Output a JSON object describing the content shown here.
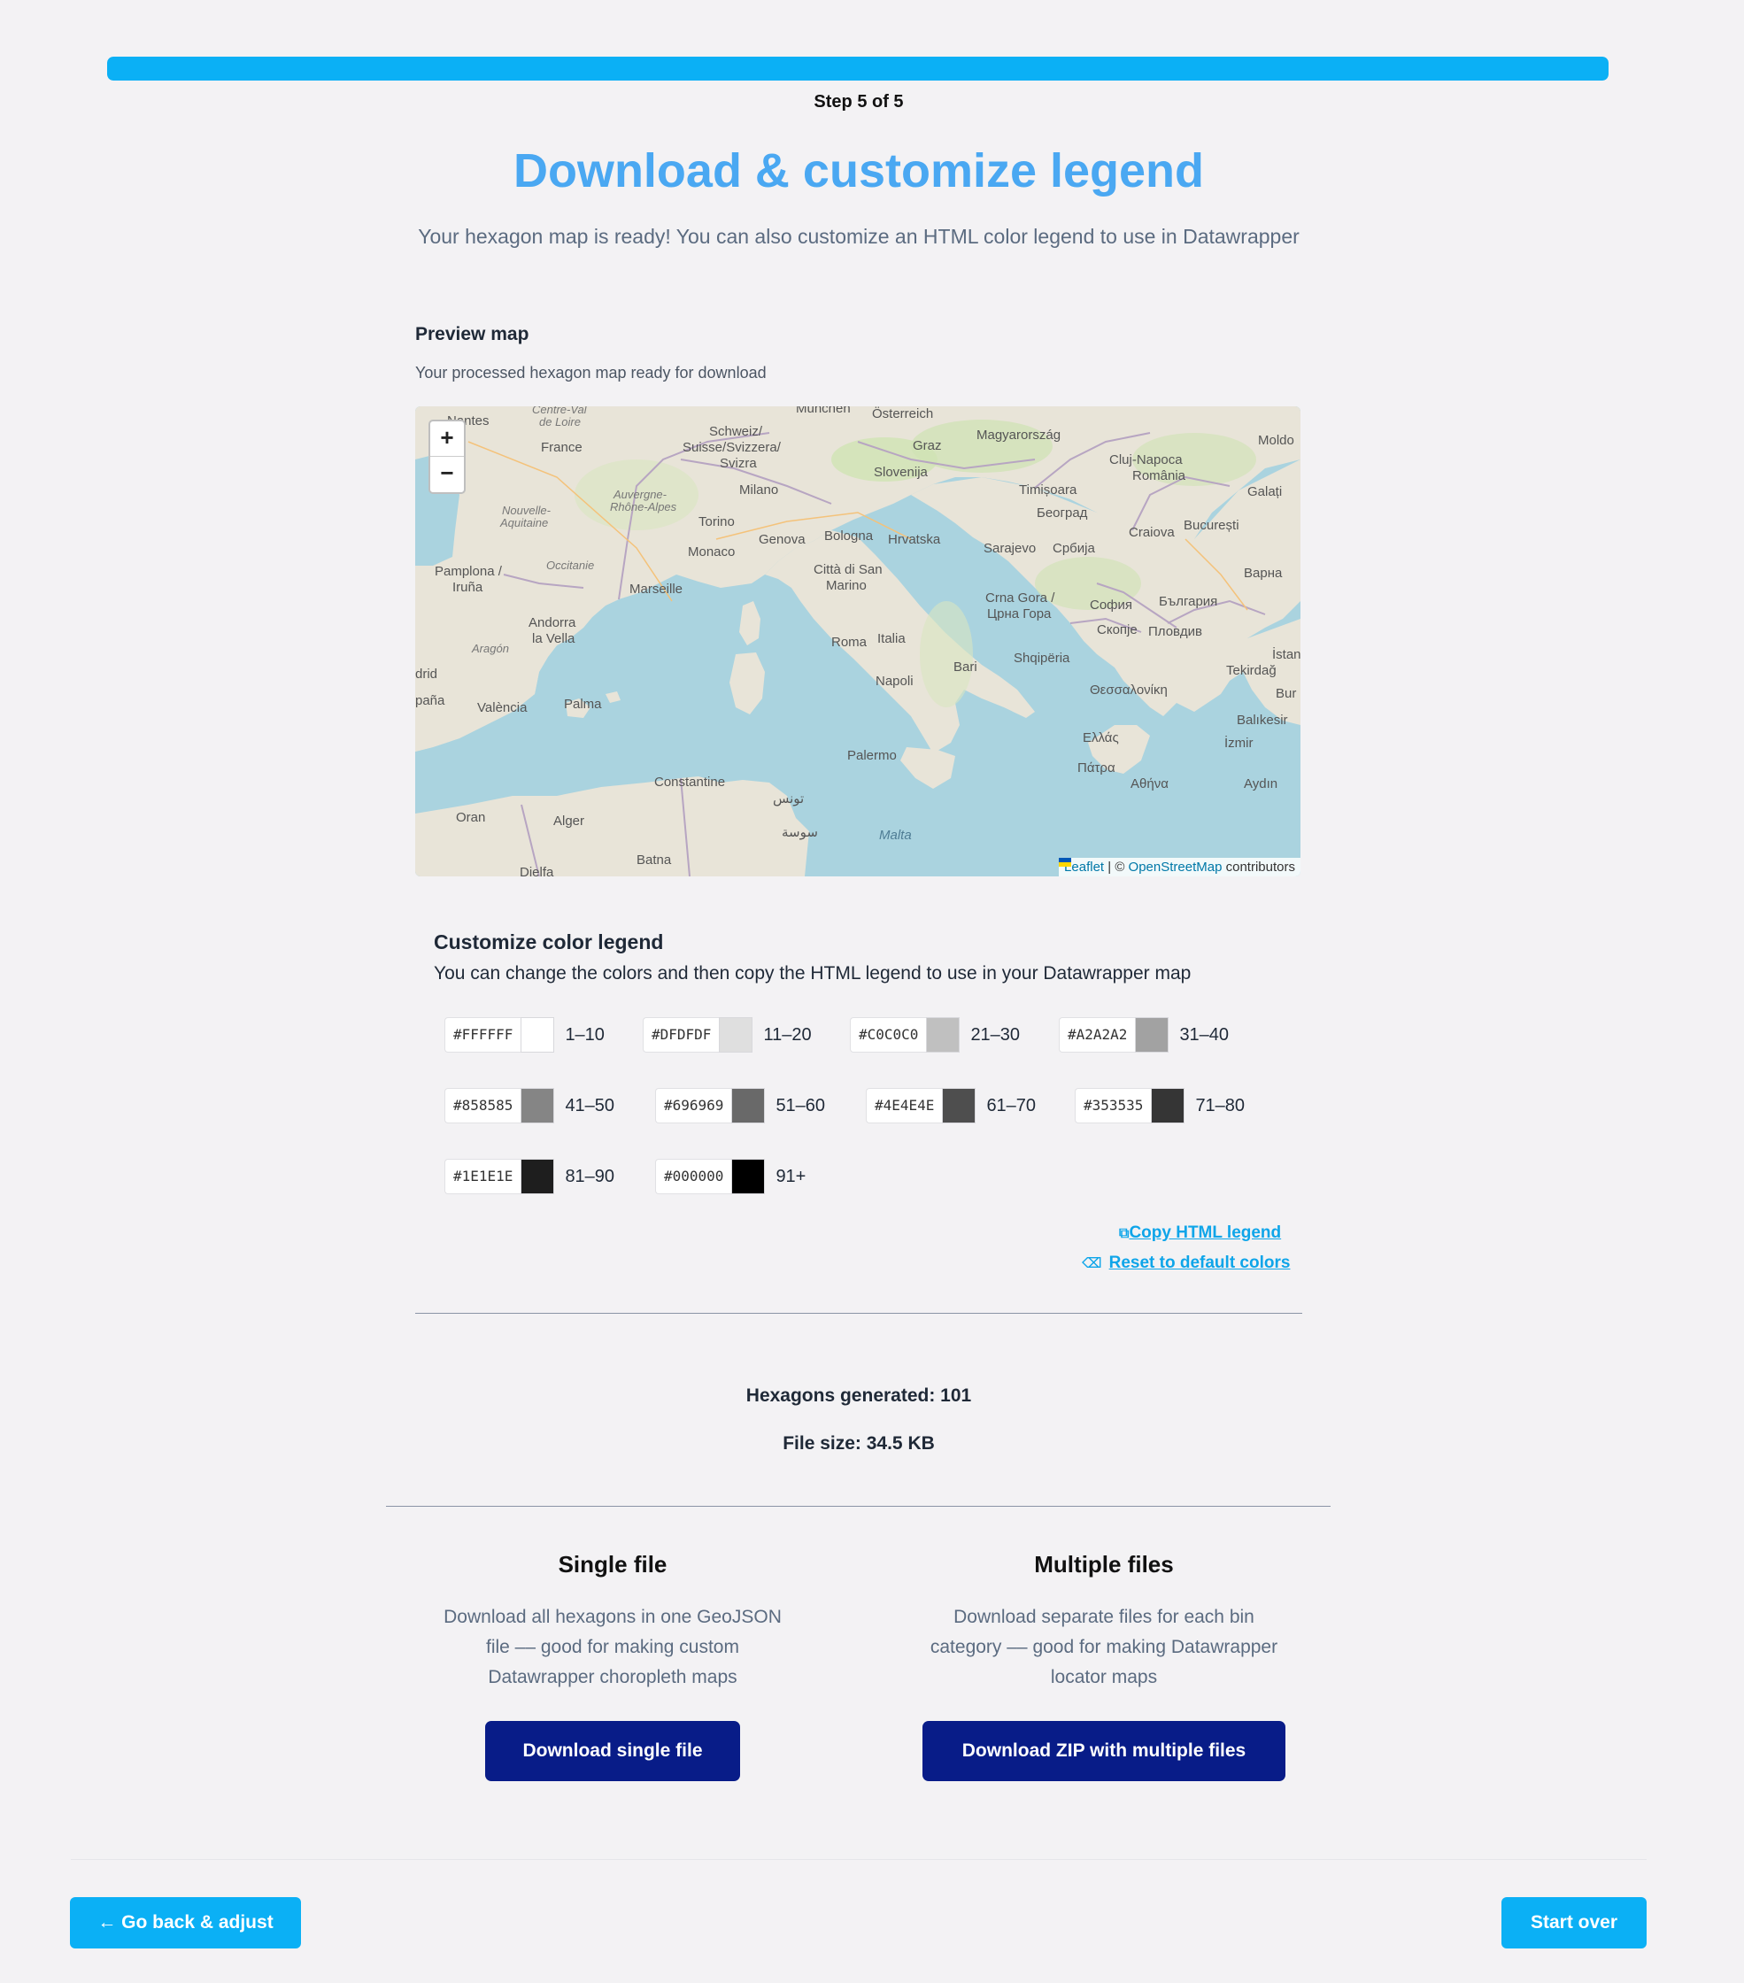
{
  "progress": {
    "label": "Step 5 of 5",
    "fraction": 1.0,
    "color": "#0bb0f5"
  },
  "header": {
    "title": "Download & customize legend",
    "subtitle": "Your hexagon map is ready! You can also customize an HTML color legend to use in Datawrapper"
  },
  "preview": {
    "heading": "Preview map",
    "description": "Your processed hexagon map ready for download",
    "zoom_in": "+",
    "zoom_out": "−",
    "attribution": {
      "leaflet": "Leaflet",
      "sep": " | © ",
      "osm": "OpenStreetMap",
      "suffix": " contributors"
    },
    "labels": {
      "nantes": "Nantes",
      "centre": "Centre-Val",
      "deloire": "de Loire",
      "munchen": "München",
      "osterreich": "Österreich",
      "magyar": "Magyarország",
      "moldo": "Moldo",
      "france": "France",
      "schweiz": "Schweiz/",
      "suisse": "Suisse/Svizzera/",
      "svizra": "Svizra",
      "graz": "Graz",
      "cluj": "Cluj-Napoca",
      "romania": "România",
      "slovenija": "Slovenija",
      "milano": "Milano",
      "auvergne": "Auvergne-",
      "rhone": "Rhône-Alpes",
      "timisoara": "Timișoara",
      "galati": "Galați",
      "nouvelle": "Nouvelle-",
      "aquitaine": "Aquitaine",
      "torino": "Torino",
      "beograd": "Београд",
      "bucuresti": "București",
      "genova": "Genova",
      "bologna": "Bologna",
      "hrvatska": "Hrvatska",
      "craiova": "Craiova",
      "monaco": "Monaco",
      "sarajevo": "Sarajevo",
      "srbija": "Србија",
      "occitanie": "Occitanie",
      "pamplona": "Pamplona /",
      "iruna": "Iruña",
      "sanmarino1": "Città di San",
      "sanmarino2": "Marino",
      "marseille": "Marseille",
      "varna": "Варна",
      "crnagora1": "Crna Gora /",
      "crnagora2": "Црна Гора",
      "sofia": "София",
      "bulgaria": "България",
      "andorra1": "Andorra",
      "andorra2": "la Vella",
      "skopje": "Скопје",
      "plovdiv": "Пловдив",
      "roma": "Roma",
      "italia": "Italia",
      "aragon": "Aragón",
      "istanbul": "İstanb",
      "shqiperia": "Shqipëria",
      "bari": "Bari",
      "tekirdag": "Tekirdağ",
      "drid": "drid",
      "napoli": "Napoli",
      "thessaloniki": "Θεσσαλονίκη",
      "bur": "Bur",
      "espana": "paña",
      "valencia": "València",
      "palma": "Palma",
      "balikesir": "Balıkesir",
      "ellas": "Ελλάς",
      "izmir": "İzmir",
      "palermo": "Palermo",
      "patra": "Πάτρα",
      "aydin": "Aydın",
      "athina": "Αθήνα",
      "constantine": "Constantine",
      "tunis": "تونس",
      "oran": "Oran",
      "alger": "Alger",
      "malta": "Malta",
      "sousse": "سوسة",
      "batna": "Batna",
      "djelfa": "Djelfa"
    }
  },
  "legend": {
    "heading": "Customize color legend",
    "description": "You can change the colors and then copy the HTML legend to use in your Datawrapper map",
    "items": [
      {
        "hex": "#FFFFFF",
        "range": "1–10",
        "color": "#FFFFFF"
      },
      {
        "hex": "#DFDFDF",
        "range": "11–20",
        "color": "#DFDFDF"
      },
      {
        "hex": "#C0C0C0",
        "range": "21–30",
        "color": "#C0C0C0"
      },
      {
        "hex": "#A2A2A2",
        "range": "31–40",
        "color": "#A2A2A2"
      },
      {
        "hex": "#858585",
        "range": "41–50",
        "color": "#858585"
      },
      {
        "hex": "#696969",
        "range": "51–60",
        "color": "#696969"
      },
      {
        "hex": "#4E4E4E",
        "range": "61–70",
        "color": "#4E4E4E"
      },
      {
        "hex": "#353535",
        "range": "71–80",
        "color": "#353535"
      },
      {
        "hex": "#1E1E1E",
        "range": "81–90",
        "color": "#1E1E1E"
      },
      {
        "hex": "#000000",
        "range": "91+",
        "color": "#000000"
      }
    ],
    "copy_label": "Copy HTML legend",
    "reset_label": "Reset to default colors"
  },
  "stats": {
    "hexagons": "Hexagons generated: 101",
    "file_size": "File size: 34.5 KB"
  },
  "download": {
    "single": {
      "title": "Single file",
      "desc1": "Download all hexagons in one GeoJSON",
      "desc2": "file –– good for making custom",
      "desc3": "Datawrapper choropleth maps",
      "button": "Download single file"
    },
    "multiple": {
      "title": "Multiple files",
      "desc1": "Download separate files for each bin",
      "desc2": "category –– good for making Datawrapper",
      "desc3": "locator maps",
      "button": "Download ZIP with multiple files"
    }
  },
  "footer": {
    "back_label": "← Go back & adjust",
    "start_over_label": "Start over"
  },
  "colors": {
    "accent": "#0bb0f5",
    "title": "#4aa8f2",
    "dark_button": "#081c88",
    "link": "#0ea5e9"
  }
}
